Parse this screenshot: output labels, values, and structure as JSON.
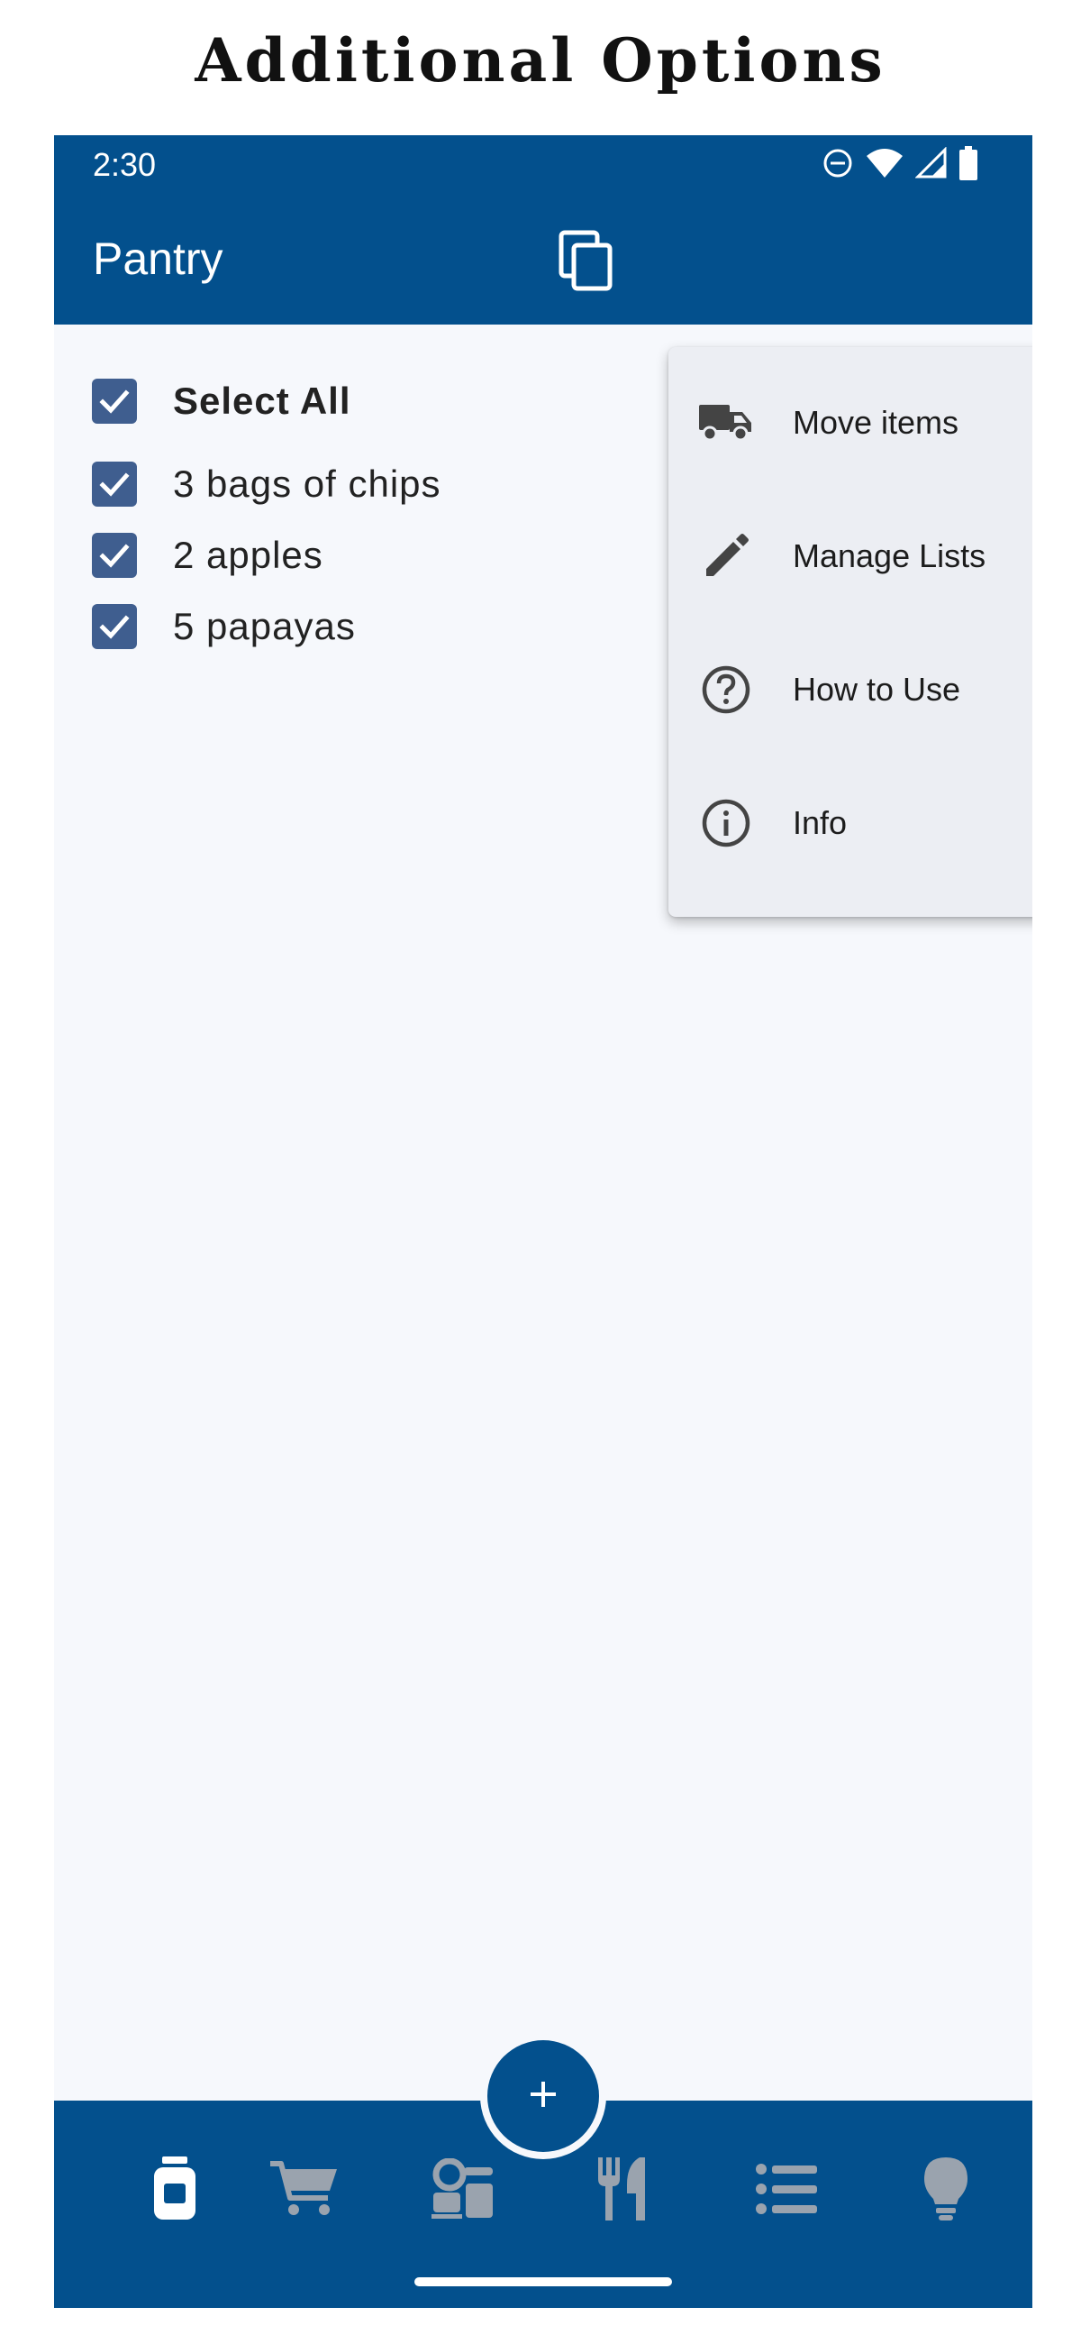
{
  "header": {
    "caption": "Additional Options"
  },
  "status_bar": {
    "time": "2:30",
    "icons": [
      "do-not-disturb-icon",
      "wifi-icon",
      "signal-icon",
      "battery-icon"
    ]
  },
  "app_bar": {
    "title": "Pantry",
    "actions": [
      "copy-icon"
    ]
  },
  "list": {
    "select_all": {
      "label": "Select All",
      "checked": true
    },
    "items": [
      {
        "label": "3 bags of chips",
        "checked": true
      },
      {
        "label": "2 apples",
        "checked": true
      },
      {
        "label": "5 papayas",
        "checked": true
      }
    ]
  },
  "overflow_menu": {
    "items": [
      {
        "label": "Move items",
        "icon": "truck-icon"
      },
      {
        "label": "Manage Lists",
        "icon": "pencil-icon"
      },
      {
        "label": "How to Use",
        "icon": "help-circle-icon"
      },
      {
        "label": "Info",
        "icon": "info-icon"
      }
    ]
  },
  "fab": {
    "icon": "plus-icon"
  },
  "bottom_nav": {
    "items": [
      {
        "icon": "jar-icon",
        "active": true
      },
      {
        "icon": "cart-icon",
        "active": false
      },
      {
        "icon": "kitchen-appliances-icon",
        "active": false
      },
      {
        "icon": "fork-knife-icon",
        "active": false
      },
      {
        "icon": "list-icon",
        "active": false
      },
      {
        "icon": "lightbulb-icon",
        "active": false
      }
    ]
  },
  "colors": {
    "primary": "#03508d",
    "checkbox": "#3f5e8f",
    "background": "#f6f8fc",
    "menu_background": "#eceef3",
    "inactive_nav_icon": "#9aa3ae"
  }
}
